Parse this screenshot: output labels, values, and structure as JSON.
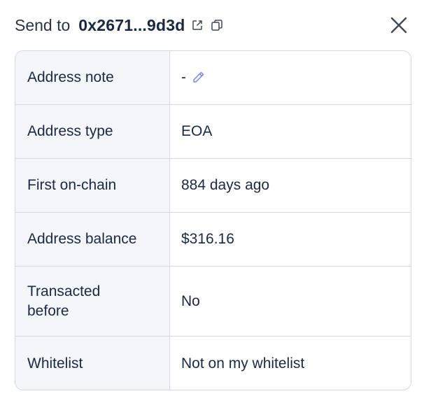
{
  "header": {
    "send_to_label": "Send to",
    "address": "0x2671...9d3d"
  },
  "icons": {
    "external_link": "external-link-icon",
    "copy": "copy-icon",
    "close": "close-icon",
    "edit": "pencil-icon"
  },
  "rows": [
    {
      "label": "Address note",
      "value": "-"
    },
    {
      "label": "Address type",
      "value": "EOA"
    },
    {
      "label": "First on-chain",
      "value": "884 days ago"
    },
    {
      "label": "Address balance",
      "value": "$316.16"
    },
    {
      "label": "Transacted before",
      "value": "No"
    },
    {
      "label": "Whitelist",
      "value": "Not on my whitelist"
    }
  ],
  "colors": {
    "text": "#192945",
    "label_bg": "#f5f6fa",
    "border": "#d3d8e0",
    "accent_icon": "#7084ff"
  }
}
